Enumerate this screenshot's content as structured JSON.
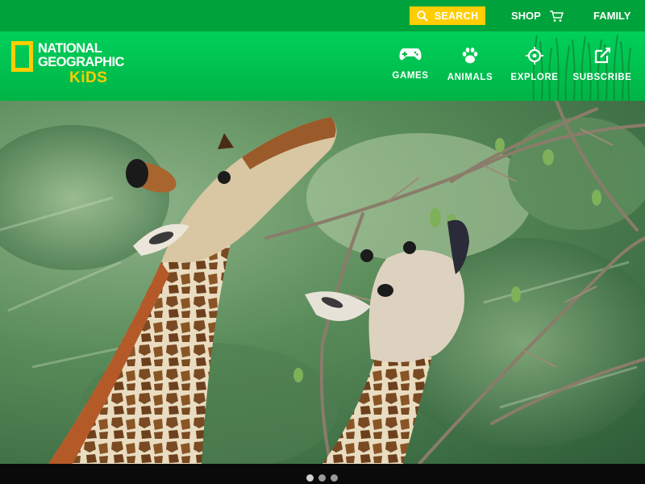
{
  "topbar": {
    "search_label": "SEARCH",
    "shop_label": "SHOP",
    "family_label": "FAMILY"
  },
  "logo": {
    "line1": "NATIONAL",
    "line2": "GEOGRAPHIC",
    "line3": "KiDS"
  },
  "nav": {
    "games": "GAMES",
    "animals": "ANIMALS",
    "explore": "EXPLORE",
    "subscribe": "SUBSCRIBE"
  },
  "hero": {
    "icon": "giraffes-photo"
  },
  "carousel": {
    "dot_count": 3,
    "active_index": 0
  },
  "colors": {
    "topbar": "#00a33b",
    "navbar": "#00c450",
    "accent_yellow": "#ffcd00"
  }
}
